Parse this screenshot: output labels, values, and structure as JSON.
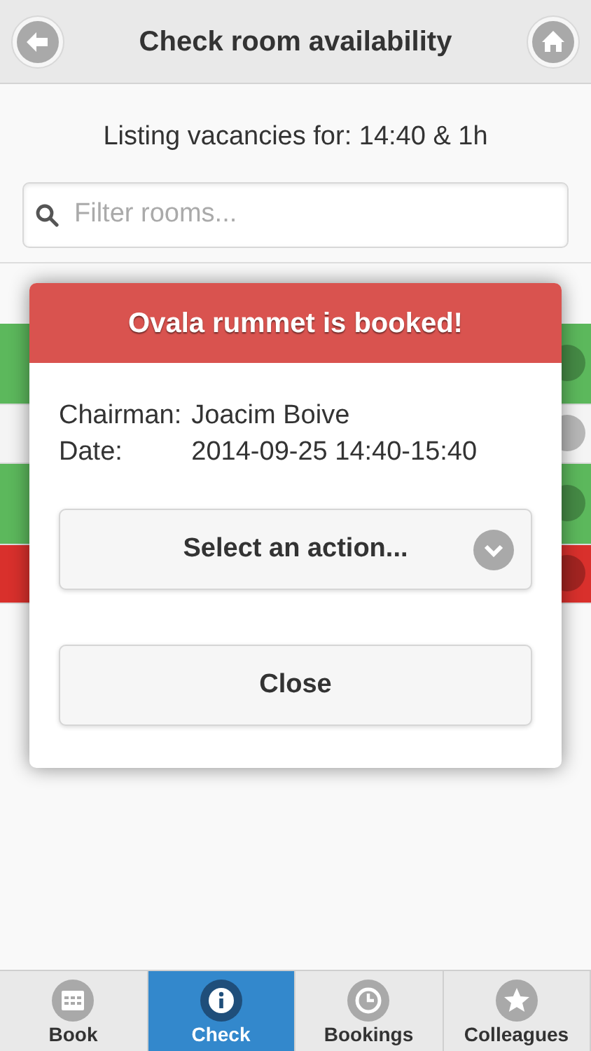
{
  "header": {
    "title": "Check room availability"
  },
  "subtitle": "Listing vacancies for: 14:40 & 1h",
  "search": {
    "placeholder": "Filter rooms..."
  },
  "rooms": [
    {
      "color": "#5cb85c"
    },
    {
      "color": "#f4f4f4"
    },
    {
      "color": "#5cb85c"
    },
    {
      "color": "#d9302c"
    }
  ],
  "dialog": {
    "title": "Ovala rummet is booked!",
    "details": [
      {
        "label": "Chairman:",
        "value": "Joacim Boive"
      },
      {
        "label": "Date:",
        "value": "2014-09-25 14:40-15:40"
      }
    ],
    "select": {
      "label": "Select an action..."
    },
    "close_button": "Close"
  },
  "tabs": [
    {
      "label": "Book",
      "kind": "calendar",
      "selected": false
    },
    {
      "label": "Check",
      "kind": "info",
      "selected": true
    },
    {
      "label": "Bookings",
      "kind": "clock",
      "selected": false
    },
    {
      "label": "Colleagues",
      "kind": "star",
      "selected": false
    }
  ]
}
